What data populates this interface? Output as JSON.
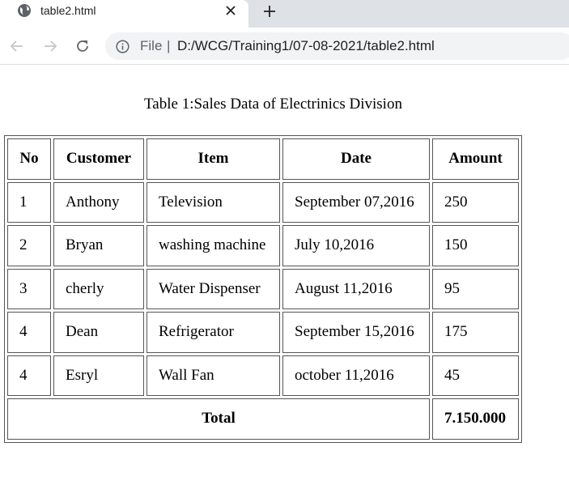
{
  "browser": {
    "tab_title": "table2.html",
    "scheme_label": "File",
    "separator": "|",
    "url": "D:/WCG/Training1/07-08-2021/table2.html"
  },
  "page": {
    "caption": "Table 1:Sales Data of Electrinics Division",
    "headers": {
      "no": "No",
      "customer": "Customer",
      "item": "Item",
      "date": "Date",
      "amount": "Amount"
    },
    "rows": [
      {
        "no": "1",
        "customer": "Anthony",
        "item": "Television",
        "date": "September 07,2016",
        "amount": "250"
      },
      {
        "no": "2",
        "customer": "Bryan",
        "item": "washing machine",
        "date": "July 10,2016",
        "amount": "150"
      },
      {
        "no": "3",
        "customer": "cherly",
        "item": "Water Dispenser",
        "date": "August 11,2016",
        "amount": "95"
      },
      {
        "no": "4",
        "customer": "Dean",
        "item": "Refrigerator",
        "date": "September 15,2016",
        "amount": "175"
      },
      {
        "no": "4",
        "customer": "Esryl",
        "item": "Wall Fan",
        "date": "october 11,2016",
        "amount": "45"
      }
    ],
    "total_label": "Total",
    "total_value": "7.150.000"
  }
}
